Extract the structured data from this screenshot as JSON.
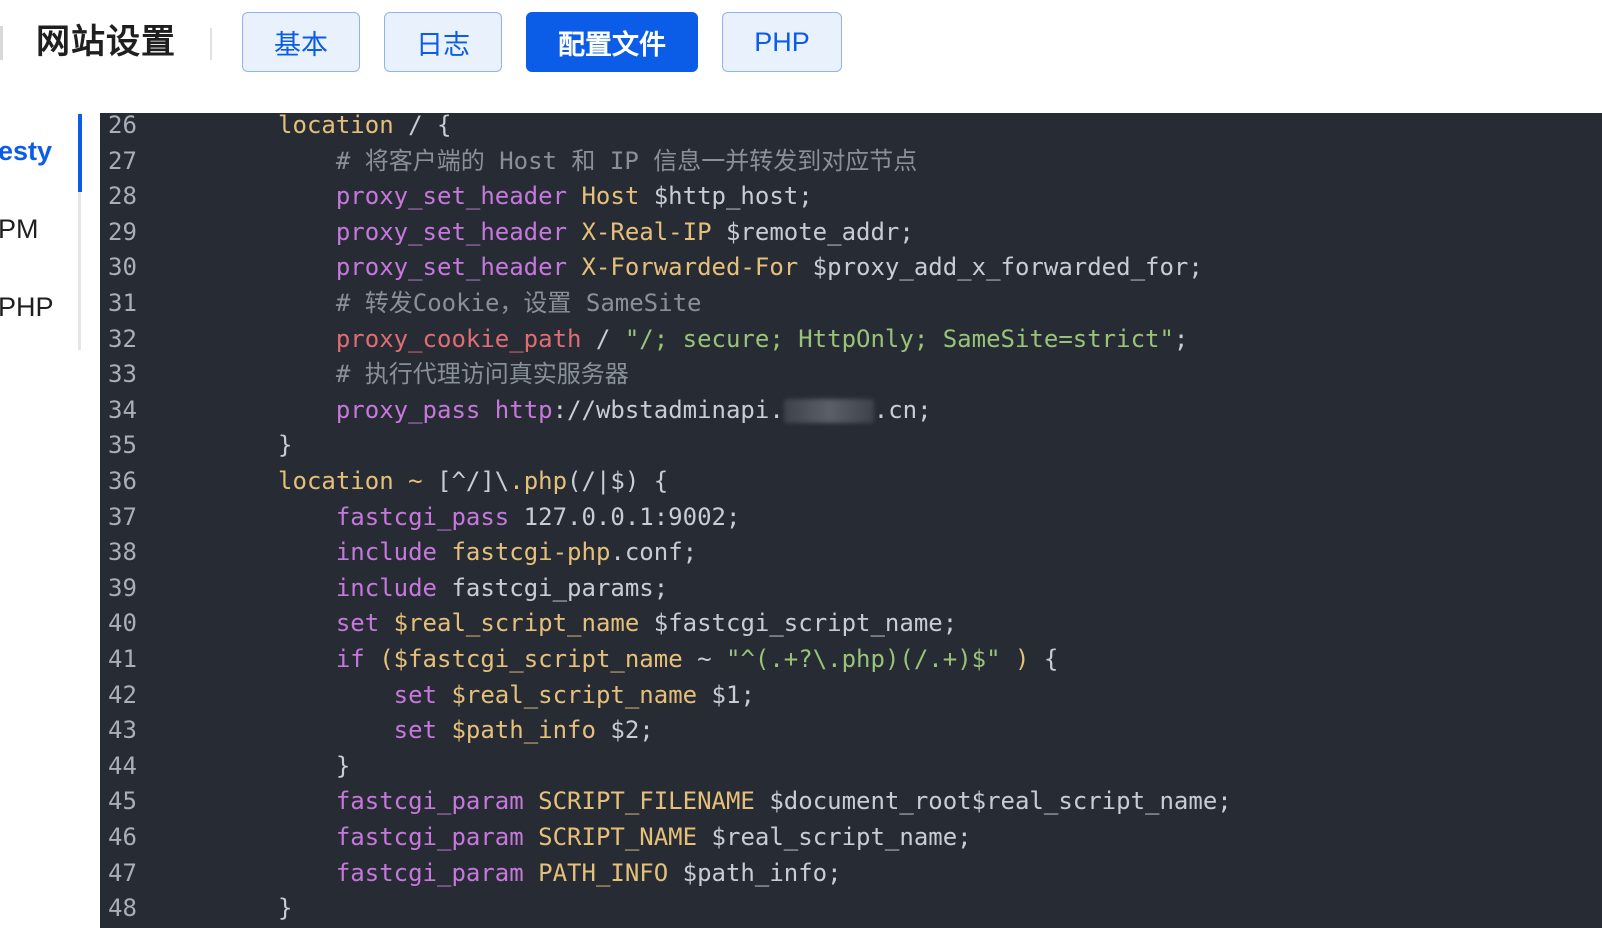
{
  "header": {
    "title": "网站设置",
    "tabs": [
      {
        "label": "基本",
        "active": false
      },
      {
        "label": "日志",
        "active": false
      },
      {
        "label": "配置文件",
        "active": true
      },
      {
        "label": "PHP",
        "active": false
      }
    ]
  },
  "sidebar": {
    "items": [
      {
        "label": "esty",
        "active": true
      },
      {
        "label": "PM",
        "active": false
      },
      {
        "label": "PHP",
        "active": false
      }
    ]
  },
  "editor": {
    "lines": [
      {
        "num": "26",
        "parts": [
          {
            "t": "    ",
            "c": ""
          },
          {
            "t": "location",
            "c": "prop"
          },
          {
            "t": " / {",
            "c": ""
          }
        ]
      },
      {
        "num": "27",
        "parts": [
          {
            "t": "        ",
            "c": ""
          },
          {
            "t": "# 将客户端的 Host 和 IP 信息一并转发到对应节点",
            "c": "cmt"
          }
        ]
      },
      {
        "num": "28",
        "parts": [
          {
            "t": "        ",
            "c": ""
          },
          {
            "t": "proxy_set_header",
            "c": "kw"
          },
          {
            "t": " ",
            "c": ""
          },
          {
            "t": "Host",
            "c": "prop"
          },
          {
            "t": " $http_host;",
            "c": ""
          }
        ]
      },
      {
        "num": "29",
        "parts": [
          {
            "t": "        ",
            "c": ""
          },
          {
            "t": "proxy_set_header",
            "c": "kw"
          },
          {
            "t": " ",
            "c": ""
          },
          {
            "t": "X-Real-IP",
            "c": "prop"
          },
          {
            "t": " $remote_addr;",
            "c": ""
          }
        ]
      },
      {
        "num": "30",
        "parts": [
          {
            "t": "        ",
            "c": ""
          },
          {
            "t": "proxy_set_header",
            "c": "kw"
          },
          {
            "t": " ",
            "c": ""
          },
          {
            "t": "X-Forwarded-For",
            "c": "prop"
          },
          {
            "t": " $proxy_add_x_forwarded_for;",
            "c": ""
          }
        ]
      },
      {
        "num": "31",
        "parts": [
          {
            "t": "        ",
            "c": ""
          },
          {
            "t": "# 转发Cookie，设置 SameSite",
            "c": "cmt"
          }
        ]
      },
      {
        "num": "32",
        "parts": [
          {
            "t": "        ",
            "c": ""
          },
          {
            "t": "proxy_cookie_path",
            "c": "dir"
          },
          {
            "t": " / ",
            "c": ""
          },
          {
            "t": "\"/; secure; HttpOnly; SameSite=strict\"",
            "c": "str"
          },
          {
            "t": ";",
            "c": ""
          }
        ]
      },
      {
        "num": "33",
        "parts": [
          {
            "t": "        ",
            "c": ""
          },
          {
            "t": "# 执行代理访问真实服务器",
            "c": "cmt"
          }
        ]
      },
      {
        "num": "34",
        "parts": [
          {
            "t": "        ",
            "c": ""
          },
          {
            "t": "proxy_pass",
            "c": "kw"
          },
          {
            "t": " ",
            "c": ""
          },
          {
            "t": "http",
            "c": "kw"
          },
          {
            "t": "://wbstadminapi.",
            "c": ""
          },
          {
            "t": "",
            "c": "blur"
          },
          {
            "t": ".cn;",
            "c": ""
          }
        ]
      },
      {
        "num": "35",
        "parts": [
          {
            "t": "    }",
            "c": ""
          }
        ]
      },
      {
        "num": "36",
        "parts": [
          {
            "t": "    ",
            "c": ""
          },
          {
            "t": "location",
            "c": "prop"
          },
          {
            "t": " ",
            "c": ""
          },
          {
            "t": "~",
            "c": "prop"
          },
          {
            "t": " [^/]\\",
            "c": ""
          },
          {
            "t": ".php",
            "c": "prop"
          },
          {
            "t": "(/|$) {",
            "c": ""
          }
        ]
      },
      {
        "num": "37",
        "parts": [
          {
            "t": "        ",
            "c": ""
          },
          {
            "t": "fastcgi_pass",
            "c": "kw"
          },
          {
            "t": " 127.0.0.1:9002;",
            "c": ""
          }
        ]
      },
      {
        "num": "38",
        "parts": [
          {
            "t": "        ",
            "c": ""
          },
          {
            "t": "include",
            "c": "kw"
          },
          {
            "t": " ",
            "c": ""
          },
          {
            "t": "fastcgi-php",
            "c": "prop"
          },
          {
            "t": ".conf;",
            "c": ""
          }
        ]
      },
      {
        "num": "39",
        "parts": [
          {
            "t": "        ",
            "c": ""
          },
          {
            "t": "include",
            "c": "kw"
          },
          {
            "t": " fastcgi_params;",
            "c": ""
          }
        ]
      },
      {
        "num": "40",
        "parts": [
          {
            "t": "        ",
            "c": ""
          },
          {
            "t": "set",
            "c": "kw"
          },
          {
            "t": " ",
            "c": ""
          },
          {
            "t": "$real_script_name",
            "c": "prop"
          },
          {
            "t": " $fastcgi_script_name;",
            "c": ""
          }
        ]
      },
      {
        "num": "41",
        "parts": [
          {
            "t": "        ",
            "c": ""
          },
          {
            "t": "if",
            "c": "kw"
          },
          {
            "t": " ",
            "c": ""
          },
          {
            "t": "($fastcgi_script_name",
            "c": "prop"
          },
          {
            "t": " ~ ",
            "c": ""
          },
          {
            "t": "\"^(.+?\\.php)(/.+)$\"",
            "c": "str"
          },
          {
            "t": " ",
            "c": ""
          },
          {
            "t": ")",
            "c": "prop"
          },
          {
            "t": " {",
            "c": ""
          }
        ]
      },
      {
        "num": "42",
        "parts": [
          {
            "t": "            ",
            "c": ""
          },
          {
            "t": "set",
            "c": "kw"
          },
          {
            "t": " ",
            "c": ""
          },
          {
            "t": "$real_script_name",
            "c": "prop"
          },
          {
            "t": " $1;",
            "c": ""
          }
        ]
      },
      {
        "num": "43",
        "parts": [
          {
            "t": "            ",
            "c": ""
          },
          {
            "t": "set",
            "c": "kw"
          },
          {
            "t": " ",
            "c": ""
          },
          {
            "t": "$path_info",
            "c": "prop"
          },
          {
            "t": " $2;",
            "c": ""
          }
        ]
      },
      {
        "num": "44",
        "parts": [
          {
            "t": "        }",
            "c": ""
          }
        ]
      },
      {
        "num": "45",
        "parts": [
          {
            "t": "        ",
            "c": ""
          },
          {
            "t": "fastcgi_param",
            "c": "kw"
          },
          {
            "t": " ",
            "c": ""
          },
          {
            "t": "SCRIPT_FILENAME",
            "c": "prop"
          },
          {
            "t": " $document_root$real_script_name;",
            "c": ""
          }
        ]
      },
      {
        "num": "46",
        "parts": [
          {
            "t": "        ",
            "c": ""
          },
          {
            "t": "fastcgi_param",
            "c": "kw"
          },
          {
            "t": " ",
            "c": ""
          },
          {
            "t": "SCRIPT_NAME",
            "c": "prop"
          },
          {
            "t": " $real_script_name;",
            "c": ""
          }
        ]
      },
      {
        "num": "47",
        "parts": [
          {
            "t": "        ",
            "c": ""
          },
          {
            "t": "fastcgi_param",
            "c": "kw"
          },
          {
            "t": " ",
            "c": ""
          },
          {
            "t": "PATH_INFO",
            "c": "prop"
          },
          {
            "t": " $path_info;",
            "c": ""
          }
        ]
      },
      {
        "num": "48",
        "parts": [
          {
            "t": "    }",
            "c": ""
          }
        ]
      }
    ]
  }
}
